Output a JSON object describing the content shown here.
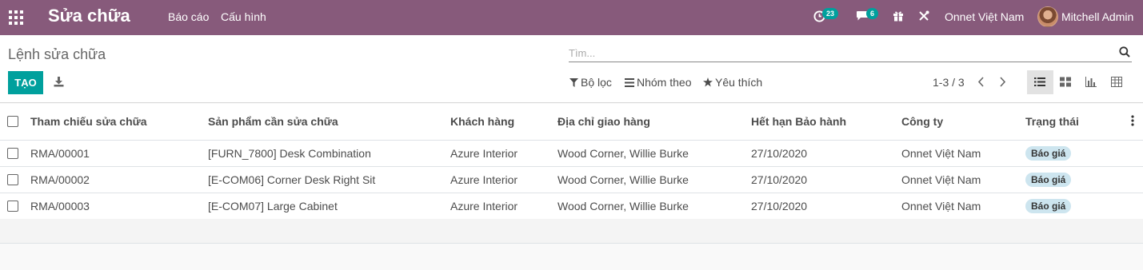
{
  "navbar": {
    "app_title": "Sửa chữa",
    "menu": [
      {
        "label": "Báo cáo"
      },
      {
        "label": "Cấu hình"
      }
    ],
    "activity_count": "23",
    "messages_count": "6",
    "company": "Onnet Việt Nam",
    "user": "Mitchell Admin"
  },
  "control_panel": {
    "breadcrumb": "Lệnh sửa chữa",
    "search_placeholder": "Tìm...",
    "create_label": "TẠO",
    "filters_label": "Bộ lọc",
    "group_by_label": "Nhóm theo",
    "favorites_label": "Yêu thích",
    "pager": "1-3 / 3"
  },
  "table": {
    "columns": [
      "Tham chiếu sửa chữa",
      "Sản phẩm cần sửa chữa",
      "Khách hàng",
      "Địa chỉ giao hàng",
      "Hết hạn Bảo hành",
      "Công ty",
      "Trạng thái"
    ],
    "rows": [
      {
        "ref": "RMA/00001",
        "product": "[FURN_7800] Desk Combination",
        "customer": "Azure Interior",
        "address": "Wood Corner, Willie Burke",
        "warranty": "27/10/2020",
        "company": "Onnet Việt Nam",
        "state": "Báo giá"
      },
      {
        "ref": "RMA/00002",
        "product": "[E-COM06] Corner Desk Right Sit",
        "customer": "Azure Interior",
        "address": "Wood Corner, Willie Burke",
        "warranty": "27/10/2020",
        "company": "Onnet Việt Nam",
        "state": "Báo giá"
      },
      {
        "ref": "RMA/00003",
        "product": "[E-COM07] Large Cabinet",
        "customer": "Azure Interior",
        "address": "Wood Corner, Willie Burke",
        "warranty": "27/10/2020",
        "company": "Onnet Việt Nam",
        "state": "Báo giá"
      }
    ]
  },
  "colors": {
    "navbar": "#875a7b",
    "primary": "#00a09d",
    "status_badge": "#cde5ef"
  }
}
